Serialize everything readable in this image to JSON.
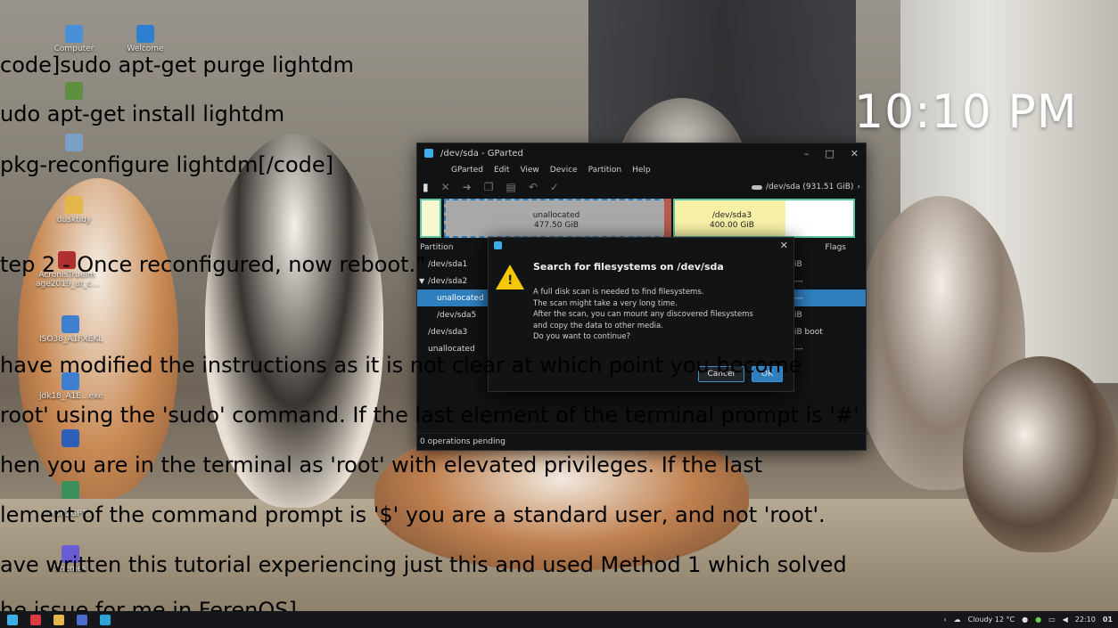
{
  "desktop": {
    "icons": [
      {
        "label": "Computer",
        "color": "#4a90d9"
      },
      {
        "label": "Welcome",
        "color": "#2d7fd1"
      },
      {
        "label": "",
        "color": "#5e8f3e"
      },
      {
        "label": "",
        "color": "#7aa0c8"
      },
      {
        "label": "dusktidy",
        "color": "#e5b64a"
      },
      {
        "label": "AcronisTrueIm age2019_ut_c...",
        "color": "#b03030"
      },
      {
        "label": "ISO38_A1FXEKL",
        "color": "#3f7fcf"
      },
      {
        "label": "jdk18_A1E...exe",
        "color": "#3f7fcf"
      },
      {
        "label": "",
        "color": "#2d5fb8"
      },
      {
        "label": "",
        "color": "#3a8f5a"
      },
      {
        "label": "MBR2GPT...",
        "color": "#666"
      },
      {
        "label": "Themes",
        "color": "#6a5bd6"
      }
    ]
  },
  "clock": {
    "time": "10:10 PM"
  },
  "gparted": {
    "title": "/dev/sda - GParted",
    "menu": [
      "GParted",
      "Edit",
      "View",
      "Device",
      "Partition",
      "Help"
    ],
    "device": "/dev/sda  (931.51 GiB)",
    "segments": [
      {
        "name": "unallocated",
        "size": "477.50 GiB"
      },
      {
        "name": "/dev/sda3",
        "size": "400.00 GiB"
      }
    ],
    "columns": {
      "partition": "Partition",
      "flags": "Flags"
    },
    "rows": [
      {
        "name": "/dev/sda1",
        "right": "iB",
        "indent": 1,
        "selected": false
      },
      {
        "name": "/dev/sda2",
        "right": "---",
        "indent": 0,
        "expander": "▼",
        "selected": false
      },
      {
        "name": "unallocated",
        "right": "---",
        "indent": 2,
        "selected": true
      },
      {
        "name": "/dev/sda5",
        "right": "iB",
        "indent": 2,
        "selected": false
      },
      {
        "name": "/dev/sda3",
        "right": "iB  boot",
        "indent": 1,
        "selected": false
      },
      {
        "name": "unallocated",
        "right": "---",
        "indent": 1,
        "selected": false
      }
    ],
    "status": "0 operations pending"
  },
  "dialog": {
    "heading": "Search for filesystems on /dev/sda",
    "lines": [
      "A full disk scan is needed to find filesystems.",
      "The scan might take a very long time.",
      "After the scan, you can mount any discovered filesystems",
      "and copy the data to other media.",
      "Do you want to continue?"
    ],
    "cancel_label": "Cancel",
    "ok_label": "OK"
  },
  "overlay_lines": [
    "code]sudo apt-get purge lightdm",
    "udo apt-get install lightdm",
    "pkg-reconfigure lightdm[/code]",
    "",
    "tep 2 - Once reconfigured, now reboot.\"",
    "",
    " have modified the instructions as it is not clear at which point you become",
    "root' using the 'sudo' command. If the last element of the terminal prompt is '#'",
    "hen you are in the terminal as 'root' with elevated privileges.  If the last",
    "lement of the command prompt is '$' you are a standard user, and not 'root'.",
    "ave written this tutorial experiencing just this and used Method 1 which solved",
    "he issue for me in FerenOS]"
  ],
  "taskbar": {
    "weather": "Cloudy 12 °C",
    "time": "22:10",
    "badge": "01"
  }
}
